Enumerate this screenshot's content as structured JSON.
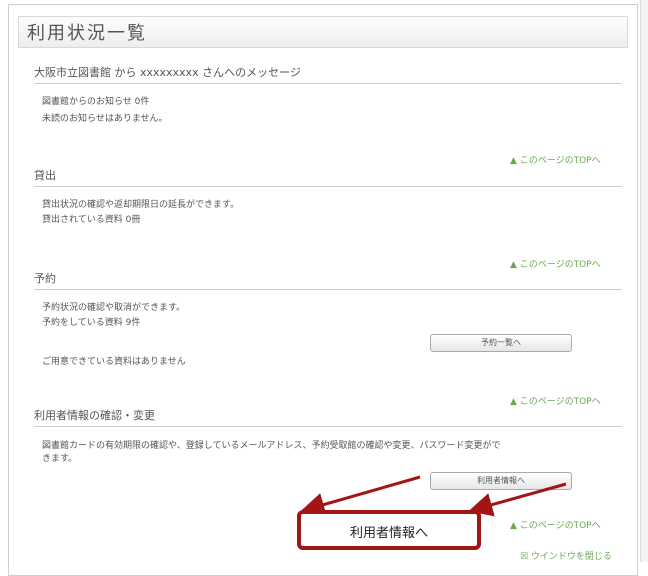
{
  "page": {
    "title": "利用状況一覧"
  },
  "message": {
    "heading": "大阪市立図書館 から xxxxxxxxx さんへのメッセージ",
    "line1": "図書館からのお知らせ 0件",
    "line2": "未読のお知らせはありません。"
  },
  "top_link": "▲ このページのTOPへ",
  "loans": {
    "heading": "貸出",
    "line1": "貸出状況の確認や返却期限日の延長ができます。",
    "line2": "貸出されている資料 0冊"
  },
  "reserve": {
    "heading": "予約",
    "line1": "予約状況の確認や取消ができます。",
    "line2": "予約をしている資料 9件",
    "button": "予約一覧へ",
    "line3": "ご用意できている資料はありません"
  },
  "user_info": {
    "heading": "利用者情報の確認・変更",
    "line1": "図書館カードの有効期限の確認や、登録しているメールアドレス、予約受取館の確認や変更、パスワード変更がで",
    "line2": "きます。",
    "button": "利用者情報へ"
  },
  "callout": {
    "label": "利用者情報へ"
  },
  "close_window": "☒ ウインドウを閉じる",
  "colors": {
    "accent_green": "#6aa84f",
    "callout_red": "#a31515"
  }
}
